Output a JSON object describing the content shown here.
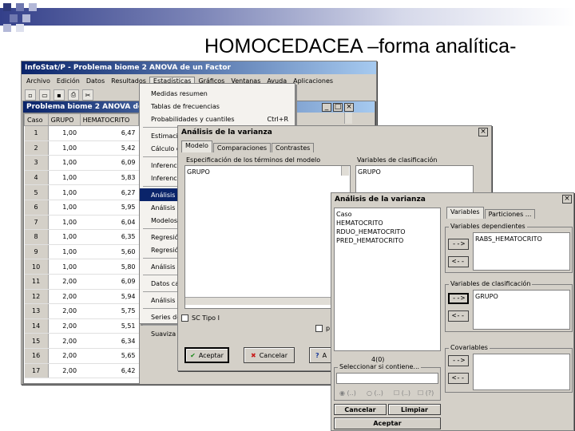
{
  "slide": {
    "title": "HOMOCEDACEA –forma analítica-"
  },
  "main_window": {
    "title": "InfoStat/P - Problema biome 2 ANOVA de un Factor",
    "menu": [
      "Archivo",
      "Edición",
      "Datos",
      "Resultados",
      "Estadísticas",
      "Gráficos",
      "Ventanas",
      "Ayuda",
      "Aplicaciones"
    ]
  },
  "data_window": {
    "title": "Problema biome 2 ANOVA de un factor",
    "columns": [
      "Caso",
      "GRUPO",
      "HEMATOCRITO"
    ],
    "rows": [
      [
        "1",
        "1,00",
        "6,47"
      ],
      [
        "2",
        "1,00",
        "5,42"
      ],
      [
        "3",
        "1,00",
        "6,09"
      ],
      [
        "4",
        "1,00",
        "5,83"
      ],
      [
        "5",
        "1,00",
        "6,27"
      ],
      [
        "6",
        "1,00",
        "5,95"
      ],
      [
        "7",
        "1,00",
        "6,04"
      ],
      [
        "8",
        "1,00",
        "6,35"
      ],
      [
        "9",
        "1,00",
        "5,60"
      ],
      [
        "10",
        "1,00",
        "5,80"
      ],
      [
        "11",
        "2,00",
        "6,09"
      ],
      [
        "12",
        "2,00",
        "5,94"
      ],
      [
        "13",
        "2,00",
        "5,75"
      ],
      [
        "14",
        "2,00",
        "5,51"
      ],
      [
        "15",
        "2,00",
        "6,34"
      ],
      [
        "16",
        "2,00",
        "5,65"
      ],
      [
        "17",
        "2,00",
        "6,42"
      ]
    ]
  },
  "stats_menu": {
    "items": [
      "Medidas resumen",
      "Tablas de frecuencias",
      "Probabilidades y cuantiles"
    ],
    "shortcut": "Ctrl+R",
    "cut_items": [
      "Estimació",
      "Cálculo d",
      "Inferenci",
      "Inferenci",
      "Análisis d",
      "Análisis c",
      "Modelos",
      "Regresió",
      "Regresió",
      "Análisis c",
      "Datos ca",
      "Análisis n",
      "Series de",
      "Suaviza"
    ]
  },
  "dialog1": {
    "title": "Análisis de la varianza",
    "tabs": [
      "Modelo",
      "Comparaciones",
      "Contrastes"
    ],
    "model_label": "Especificación de los términos del modelo",
    "model_value": "GRUPO",
    "class_label": "Variables de clasificación",
    "class_value": "GRUPO",
    "check_label": "SC Tipo I",
    "check2_label": "p",
    "accept": "Aceptar",
    "cancel": "Cancelar",
    "help": "A"
  },
  "dialog2": {
    "title": "Análisis de la varianza",
    "variables": [
      "Caso",
      "HEMATOCRITO",
      "RDUO_HEMATOCRITO",
      "PRED_HEMATOCRITO"
    ],
    "count": "4(0)",
    "filter_label": "Seleccionar si contiene...",
    "radio_labels": [
      "(..)",
      "(..)",
      "(..)",
      "(?)"
    ],
    "clear": "Cancelar",
    "limpiar": "Limpiar",
    "accept": "Aceptar",
    "tabs": [
      "Variables",
      "Particiones ..."
    ],
    "dep_label": "Variables dependientes",
    "dep_value": "RABS_HEMATOCRITO",
    "class_label": "Variables de clasificación",
    "class_value": "GRUPO",
    "cov_label": "Covariables",
    "arrow_right": "-->",
    "arrow_left": "<--"
  }
}
